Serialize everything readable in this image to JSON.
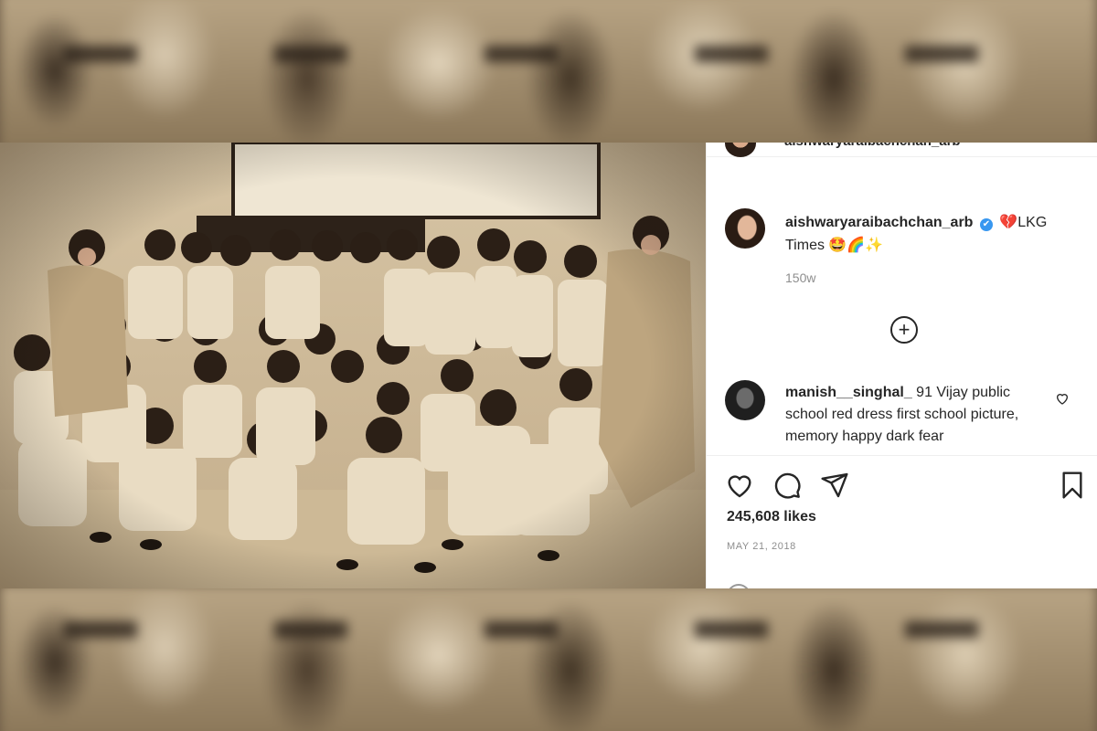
{
  "post": {
    "header_handle": "aishwaryaraibachchan_arb",
    "caption": {
      "user": "aishwaryaraibachchan_arb",
      "verified_mark": "✔",
      "text_emoji_prefix": "💔",
      "text": "LKG Times",
      "text_emoji_suffix": "🤩🌈✨"
    },
    "time_ago": "150w",
    "load_more_symbol": "+",
    "comment": {
      "user": "manish__singhal_",
      "text": "91 Vijay public school red dress first school picture, memory happy dark fear"
    },
    "likes": "245,608 likes",
    "date": "MAY 21, 2018"
  },
  "icons": {
    "like": "heart-icon",
    "comment": "comment-icon",
    "share": "share-icon",
    "save": "bookmark-icon",
    "comment_like": "heart-icon",
    "load_more": "plus-circle-icon"
  },
  "colors": {
    "text": "#262626",
    "muted": "#8e8e8e",
    "verified": "#3897f0",
    "sepia_light": "#d8c7a8",
    "sepia_dark": "#3a2c1f"
  }
}
